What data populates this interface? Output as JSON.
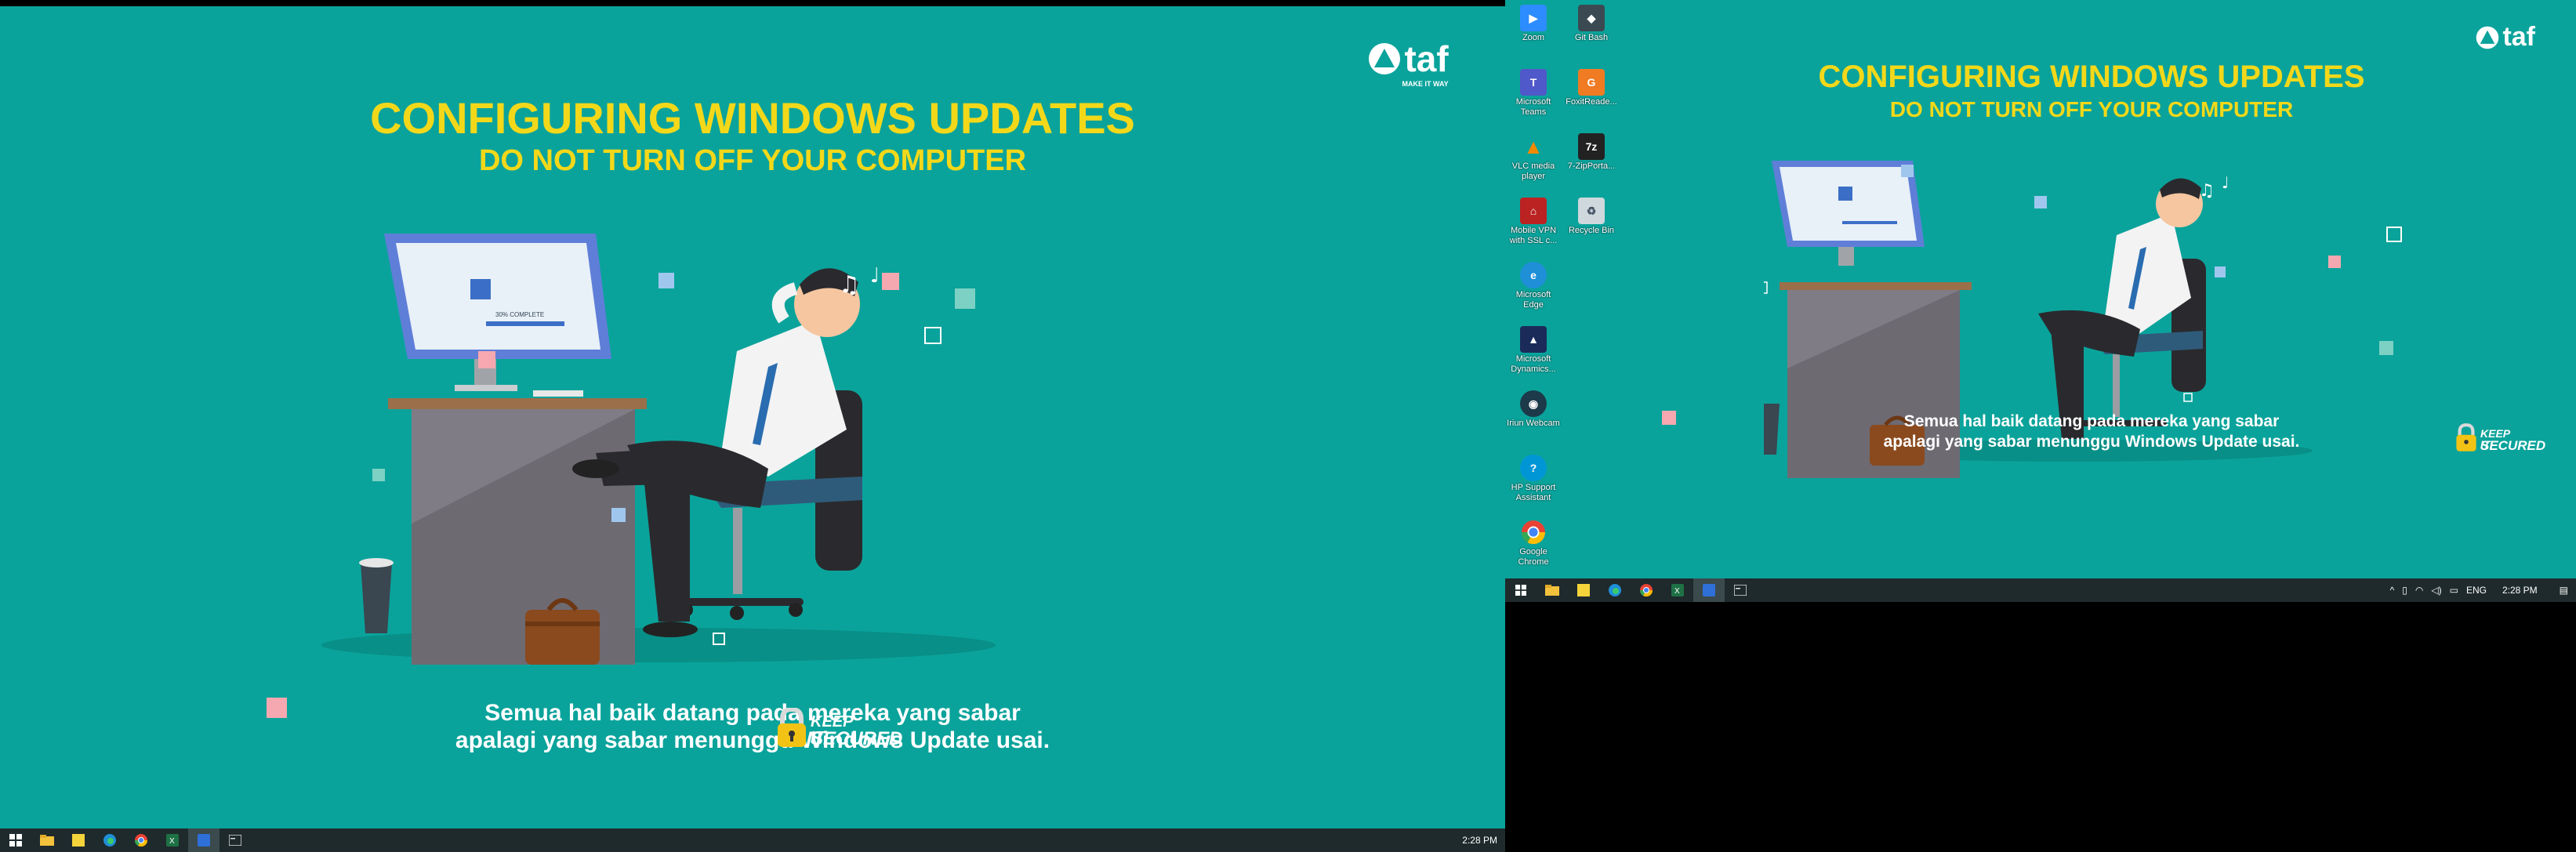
{
  "wallpaper": {
    "headline": "CONFIGURING WINDOWS UPDATES",
    "subheadline": "DO NOT TURN OFF YOUR COMPUTER",
    "caption_line1": "Semua hal baik datang pada mereka yang sabar",
    "caption_line2": "apalagi yang sabar menunggu Windows Update usai.",
    "logo_name": "taf",
    "logo_tagline": "MAKE IT WAY",
    "badge_line1": "KEEP IT",
    "badge_line2": "SECURED",
    "screen_progress": "30% COMPLETE",
    "colors": {
      "background": "#0aa39b",
      "headline": "#f3d81a",
      "text": "#ffffff",
      "taskbar": "#1f2a2c"
    }
  },
  "taskbar_left": {
    "clock": "2:28 PM"
  },
  "taskbar_right": {
    "language": "ENG",
    "clock": "2:28 PM"
  },
  "desktop_icons": [
    {
      "label": "Zoom",
      "icon": "zoom-icon"
    },
    {
      "label": "Git Bash",
      "icon": "git-bash-icon"
    },
    {
      "label": "Microsoft Teams",
      "icon": "teams-icon"
    },
    {
      "label": "FoxitReade...",
      "icon": "foxit-icon"
    },
    {
      "label": "VLC media player",
      "icon": "vlc-icon"
    },
    {
      "label": "7-ZipPorta...",
      "icon": "7zip-icon"
    },
    {
      "label": "Mobile VPN with SSL c...",
      "icon": "vpn-icon"
    },
    {
      "label": "Recycle Bin",
      "icon": "recycle-bin-icon"
    },
    {
      "label": "Microsoft Edge",
      "icon": "edge-icon"
    },
    {
      "label": "Microsoft Dynamics...",
      "icon": "dynamics-icon"
    },
    {
      "label": "Iriun Webcam",
      "icon": "webcam-icon"
    },
    {
      "label": "HP Support Assistant",
      "icon": "hp-support-icon"
    },
    {
      "label": "Google Chrome",
      "icon": "chrome-icon"
    }
  ]
}
